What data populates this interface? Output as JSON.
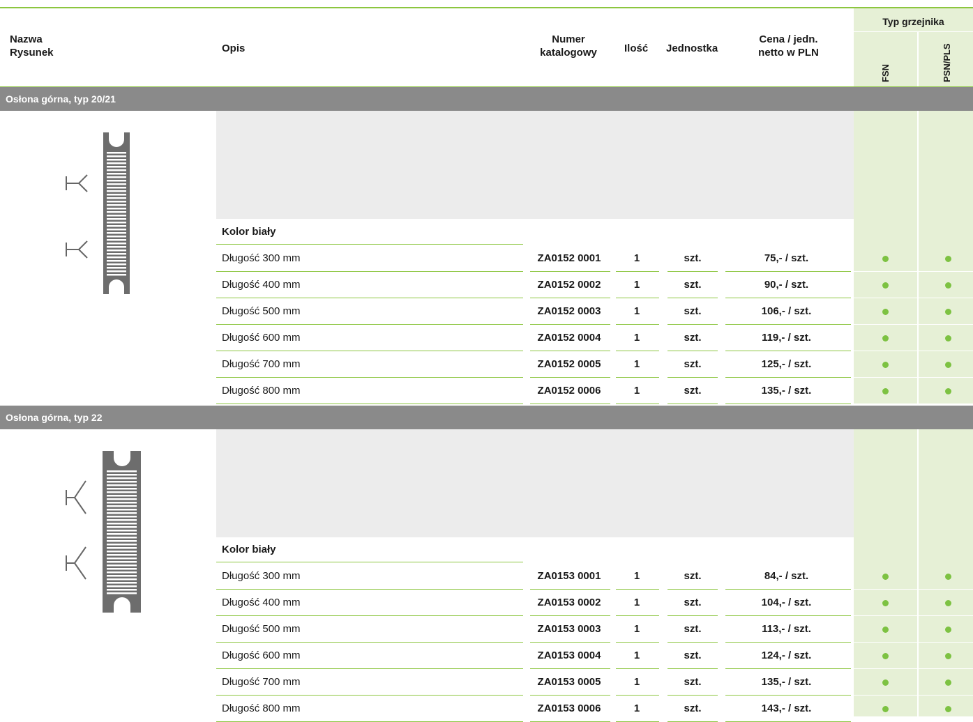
{
  "header": {
    "col_name": [
      "Nazwa",
      "Rysunek"
    ],
    "col_desc": "Opis",
    "col_catalog": [
      "Numer",
      "katalogowy"
    ],
    "col_qty": "Ilość",
    "col_unit": "Jednostka",
    "col_price": [
      "Cena / jedn.",
      "netto w PLN"
    ],
    "col_type_group": "Typ grzejnika",
    "col_type_fsn": "FSN",
    "col_type_psn": "PSN/PLS"
  },
  "sections": [
    {
      "title": "Osłona górna, typ 20/21",
      "color_label": "Kolor biały",
      "rows": [
        {
          "desc": " Długość 300 mm",
          "catalog": "ZA0152 0001",
          "qty": "1",
          "unit": "szt.",
          "price": "75,- / szt.",
          "fsn": true,
          "psn": true
        },
        {
          "desc": "Długość 400 mm",
          "catalog": "ZA0152 0002",
          "qty": "1",
          "unit": "szt.",
          "price": "90,- / szt.",
          "fsn": true,
          "psn": true
        },
        {
          "desc": "Długość 500 mm",
          "catalog": "ZA0152 0003",
          "qty": "1",
          "unit": "szt.",
          "price": "106,- / szt.",
          "fsn": true,
          "psn": true
        },
        {
          "desc": "Długość 600 mm",
          "catalog": "ZA0152 0004",
          "qty": "1",
          "unit": "szt.",
          "price": "119,- / szt.",
          "fsn": true,
          "psn": true
        },
        {
          "desc": "Długość 700 mm",
          "catalog": "ZA0152 0005",
          "qty": "1",
          "unit": "szt.",
          "price": "125,- / szt.",
          "fsn": true,
          "psn": true
        },
        {
          "desc": "Długość 800 mm",
          "catalog": "ZA0152 0006",
          "qty": "1",
          "unit": "szt.",
          "price": "135,- / szt.",
          "fsn": true,
          "psn": true
        }
      ]
    },
    {
      "title": "Osłona górna, typ 22",
      "color_label": "Kolor biały",
      "rows": [
        {
          "desc": "Długość 300 mm",
          "catalog": "ZA0153 0001",
          "qty": "1",
          "unit": "szt.",
          "price": "84,- / szt.",
          "fsn": true,
          "psn": true
        },
        {
          "desc": "Długość 400 mm",
          "catalog": "ZA0153 0002",
          "qty": "1",
          "unit": "szt.",
          "price": "104,- / szt.",
          "fsn": true,
          "psn": true
        },
        {
          "desc": "Długość 500 mm",
          "catalog": "ZA0153 0003",
          "qty": "1",
          "unit": "szt.",
          "price": "113,- / szt.",
          "fsn": true,
          "psn": true
        },
        {
          "desc": "Długość 600 mm",
          "catalog": "ZA0153 0004",
          "qty": "1",
          "unit": "szt.",
          "price": "124,- / szt.",
          "fsn": true,
          "psn": true
        },
        {
          "desc": "Długość 700 mm",
          "catalog": "ZA0153 0005",
          "qty": "1",
          "unit": "szt.",
          "price": "135,- / szt.",
          "fsn": true,
          "psn": true
        },
        {
          "desc": "Długość 800 mm",
          "catalog": "ZA0153 0006",
          "qty": "1",
          "unit": "szt.",
          "price": "143,- / szt.",
          "fsn": true,
          "psn": true
        }
      ]
    }
  ],
  "colors": {
    "accent_green": "#8cc63f",
    "dot_green": "#7dc242",
    "section_bar": "#8a8a8a",
    "type_col_bg": "#e6f0d6"
  }
}
